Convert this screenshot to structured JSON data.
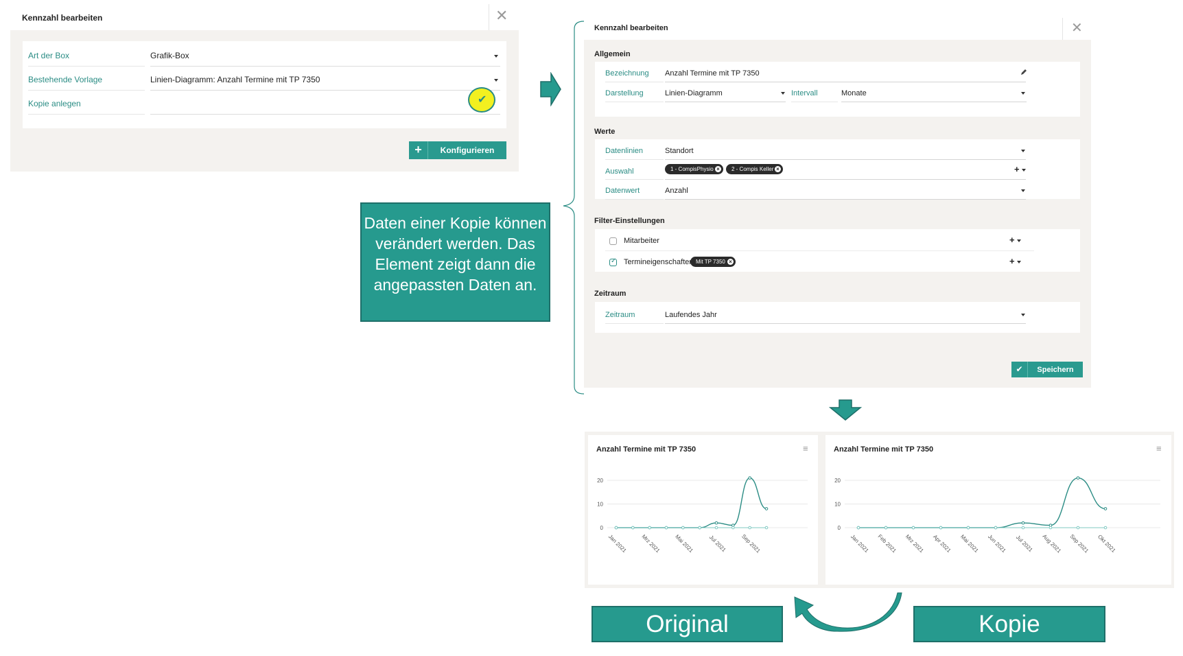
{
  "dialog1": {
    "title": "Kennzahl bearbeiten",
    "close_symbol": "✕",
    "rows": [
      {
        "label": "Art der Box",
        "value": "Grafik-Box"
      },
      {
        "label": "Bestehende Vorlage",
        "value": "Linien-Diagramm: Anzahl Termine mit TP 7350"
      },
      {
        "label": "Kopie anlegen",
        "value": ""
      }
    ],
    "check_symbol": "✔",
    "button_icon": "+",
    "button_label": "Konfigurieren"
  },
  "callout": {
    "text": "Daten einer Kopie können verändert werden. Das Element zeigt dann die angepassten Daten an."
  },
  "dialog2": {
    "title": "Kennzahl bearbeiten",
    "close_symbol": "✕",
    "allgemein": {
      "heading": "Allgemein",
      "bezeichnung_label": "Bezeichnung",
      "bezeichnung_value": "Anzahl Termine mit TP 7350",
      "darstellung_label": "Darstellung",
      "darstellung_value": "Linien-Diagramm",
      "intervall_label": "Intervall",
      "intervall_value": "Monate"
    },
    "werte": {
      "heading": "Werte",
      "datenlinien_label": "Datenlinien",
      "datenlinien_value": "Standort",
      "auswahl_label": "Auswahl",
      "auswahl_chips": [
        "1 - CompisPhysio",
        "2 - Compis Keller"
      ],
      "datenwert_label": "Datenwert",
      "datenwert_value": "Anzahl"
    },
    "filter": {
      "heading": "Filter-Einstellungen",
      "mitarbeiter_label": "Mitarbeiter",
      "termineigenschaften_label": "Termineigenschaften",
      "termineigenschaften_chip": "Mit TP 7350",
      "add_symbol": "+"
    },
    "zeitraum": {
      "heading": "Zeitraum",
      "label": "Zeitraum",
      "value": "Laufendes Jahr"
    },
    "save_icon": "✔",
    "save_label": "Speichern"
  },
  "labels": {
    "original": "Original",
    "kopie": "Kopie"
  },
  "colors": {
    "accent": "#2a9a8f",
    "accent_dark": "#1e6f69",
    "label_teal": "#2a8c84",
    "panel_bg": "#f4f2ef",
    "highlight_yellow": "#f2f020",
    "line_teal": "#2a8c84",
    "baseline": "#7fc8c2"
  },
  "chart_data": [
    {
      "type": "line",
      "title": "Anzahl Termine mit TP 7350",
      "menu_icon": "≡",
      "x_tick_labels": [
        "Jan 2021",
        "Mrz 2021",
        "Mai 2021",
        "Jul 2021",
        "Sep 2021"
      ],
      "yticks": [
        0,
        10,
        20
      ],
      "ylim": [
        0,
        20
      ],
      "categories": [
        "Jan 2021",
        "Feb 2021",
        "Mrz 2021",
        "Apr 2021",
        "Mai 2021",
        "Jun 2021",
        "Jul 2021",
        "Aug 2021",
        "Sep 2021",
        "Okt 2021"
      ],
      "series": [
        {
          "values": [
            0,
            0,
            0,
            0,
            0,
            0,
            2,
            1,
            21,
            8
          ]
        },
        {
          "values": [
            0,
            0,
            0,
            0,
            0,
            0,
            0,
            0,
            0,
            0
          ]
        }
      ]
    },
    {
      "type": "line",
      "title": "Anzahl Termine mit TP 7350",
      "menu_icon": "≡",
      "x_tick_labels": [
        "Jan 2021",
        "Feb 2021",
        "Mrz 2021",
        "Apr 2021",
        "Mai 2021",
        "Jun 2021",
        "Jul 2021",
        "Aug 2021",
        "Sep 2021",
        "Okt 2021"
      ],
      "yticks": [
        0,
        10,
        20
      ],
      "ylim": [
        0,
        20
      ],
      "categories": [
        "Jan 2021",
        "Feb 2021",
        "Mrz 2021",
        "Apr 2021",
        "Mai 2021",
        "Jun 2021",
        "Jul 2021",
        "Aug 2021",
        "Sep 2021",
        "Okt 2021"
      ],
      "series": [
        {
          "values": [
            0,
            0,
            0,
            0,
            0,
            0,
            2,
            1,
            21,
            8
          ]
        },
        {
          "values": [
            0,
            0,
            0,
            0,
            0,
            0,
            0,
            0,
            0,
            0
          ]
        }
      ]
    }
  ]
}
